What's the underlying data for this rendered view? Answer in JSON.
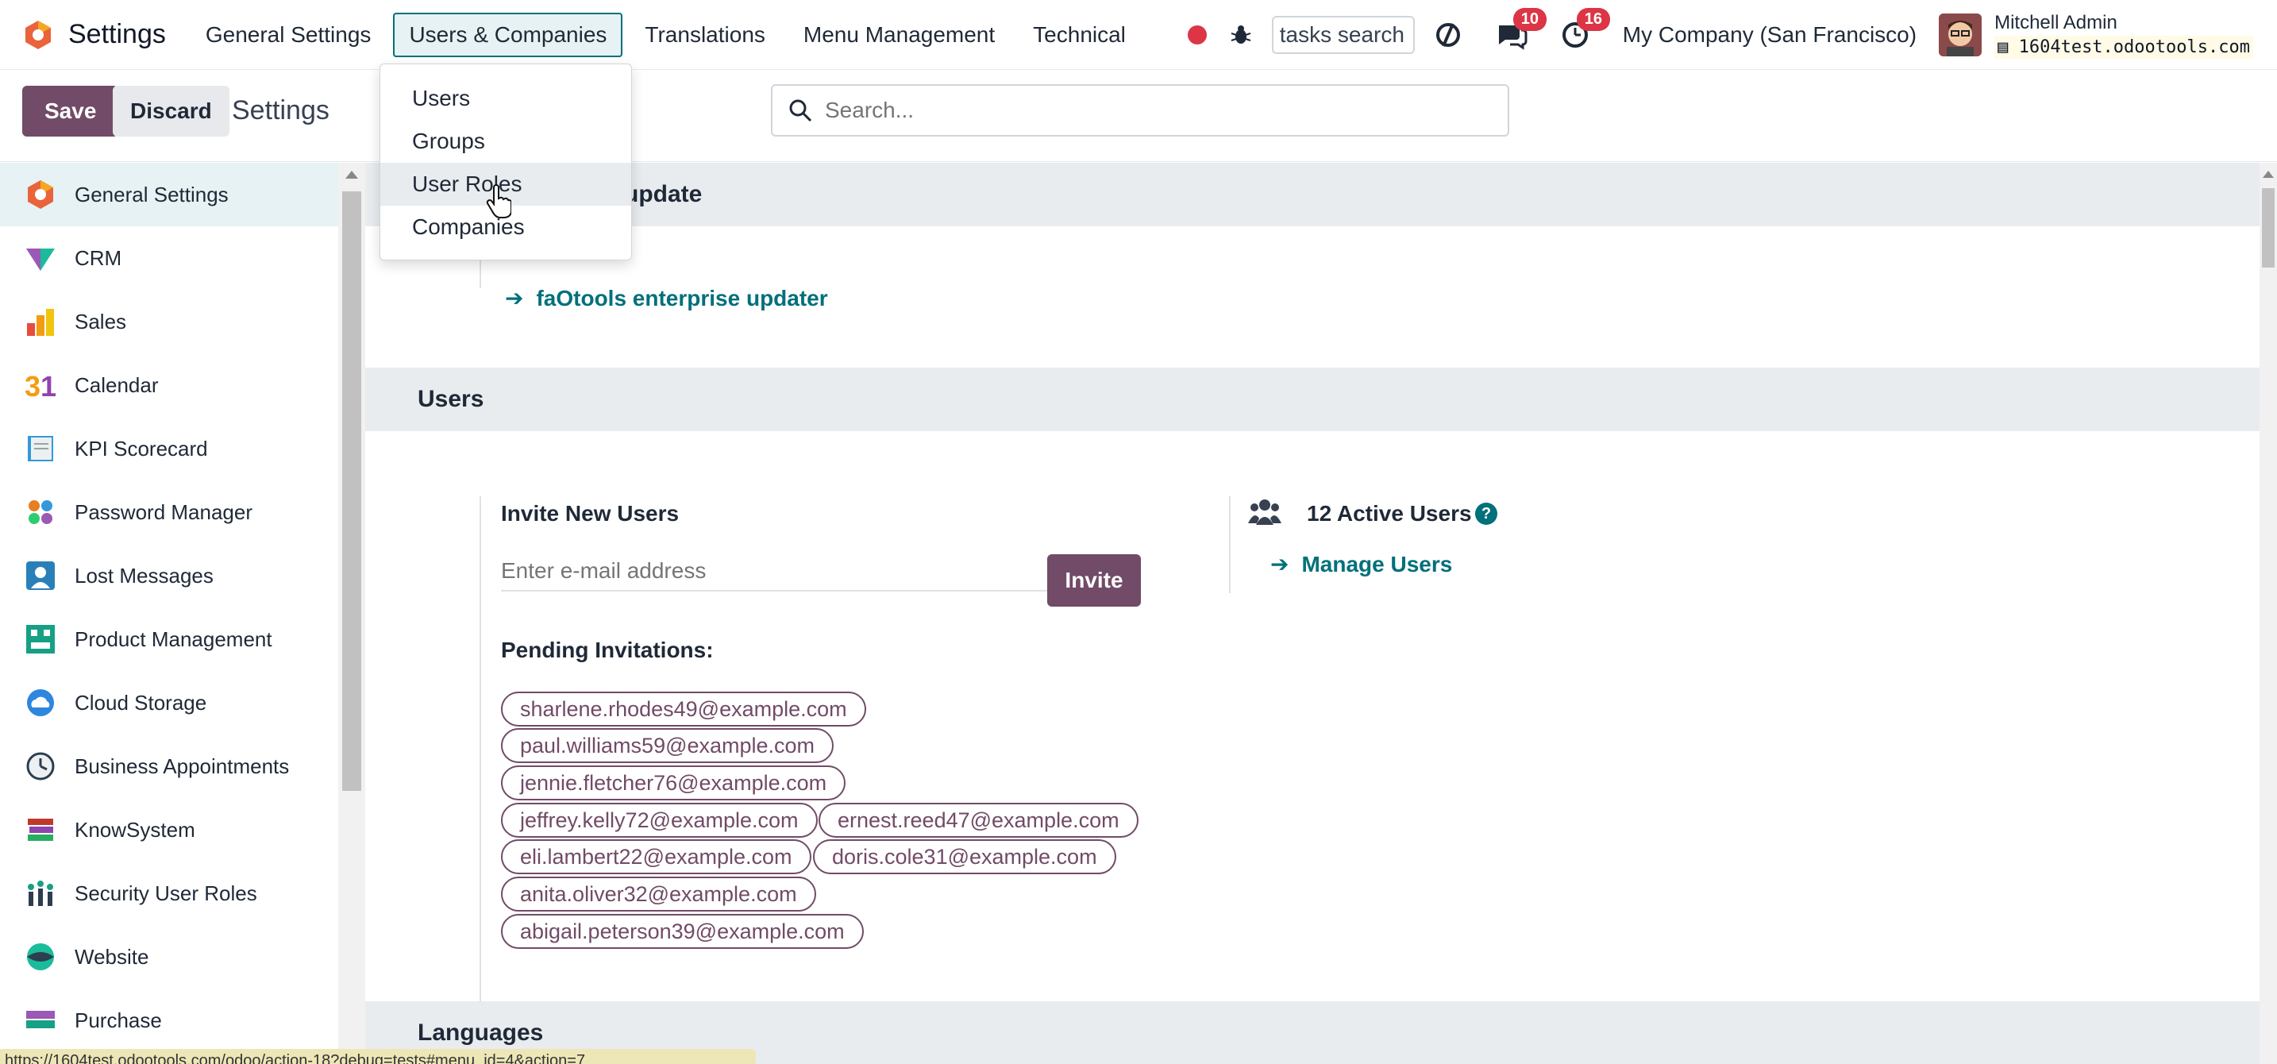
{
  "navbar": {
    "app_name": "Settings",
    "menus": [
      "General Settings",
      "Users & Companies",
      "Translations",
      "Menu Management",
      "Technical"
    ],
    "tasks_search_value": "tasks search",
    "chat_badge": "10",
    "activity_badge": "16",
    "company": "My Company (San Francisco)",
    "user_name": "Mitchell Admin",
    "db_name": "1604test.odootools.com"
  },
  "control": {
    "save_label": "Save",
    "discard_label": "Discard",
    "breadcrumb": "Settings",
    "search_placeholder": "Search..."
  },
  "dropdown": {
    "items": [
      "Users",
      "Groups",
      "User Roles",
      "Companies"
    ],
    "hovered": "User Roles"
  },
  "sidebar": {
    "items": [
      {
        "label": "General Settings",
        "icon": "settings-app-icon"
      },
      {
        "label": "CRM",
        "icon": "crm-app-icon"
      },
      {
        "label": "Sales",
        "icon": "sales-app-icon"
      },
      {
        "label": "Calendar",
        "icon": "calendar-app-icon"
      },
      {
        "label": "KPI Scorecard",
        "icon": "kpi-app-icon"
      },
      {
        "label": "Password Manager",
        "icon": "password-app-icon"
      },
      {
        "label": "Lost Messages",
        "icon": "lost-messages-app-icon"
      },
      {
        "label": "Product Management",
        "icon": "product-app-icon"
      },
      {
        "label": "Cloud Storage",
        "icon": "cloud-app-icon"
      },
      {
        "label": "Business Appointments",
        "icon": "appointments-app-icon"
      },
      {
        "label": "KnowSystem",
        "icon": "knowsystem-app-icon"
      },
      {
        "label": "Security User Roles",
        "icon": "security-roles-app-icon"
      },
      {
        "label": "Website",
        "icon": "website-app-icon"
      },
      {
        "label": "Purchase",
        "icon": "purchase-app-icon"
      }
    ]
  },
  "main": {
    "update_section_title": "update",
    "updater_link": "faOtools enterprise updater",
    "users_section_title": "Users",
    "invite_title": "Invite New Users",
    "email_placeholder": "Enter e-mail address",
    "invite_button": "Invite",
    "pending_title": "Pending Invitations:",
    "pending": [
      "sharlene.rhodes49@example.com",
      "paul.williams59@example.com",
      "jennie.fletcher76@example.com",
      "jeffrey.kelly72@example.com",
      "ernest.reed47@example.com",
      "eli.lambert22@example.com",
      "doris.cole31@example.com",
      "anita.oliver32@example.com",
      "abigail.peterson39@example.com"
    ],
    "active_users": "12 Active Users",
    "manage_users": "Manage Users",
    "languages_title": "Languages"
  },
  "status_url": "https://1604test.odootools.com/odoo/action-18?debug=tests#menu_id=4&action=7",
  "colors": {
    "primary": "#714b67",
    "link": "#00707a",
    "badge": "#dc3545"
  }
}
